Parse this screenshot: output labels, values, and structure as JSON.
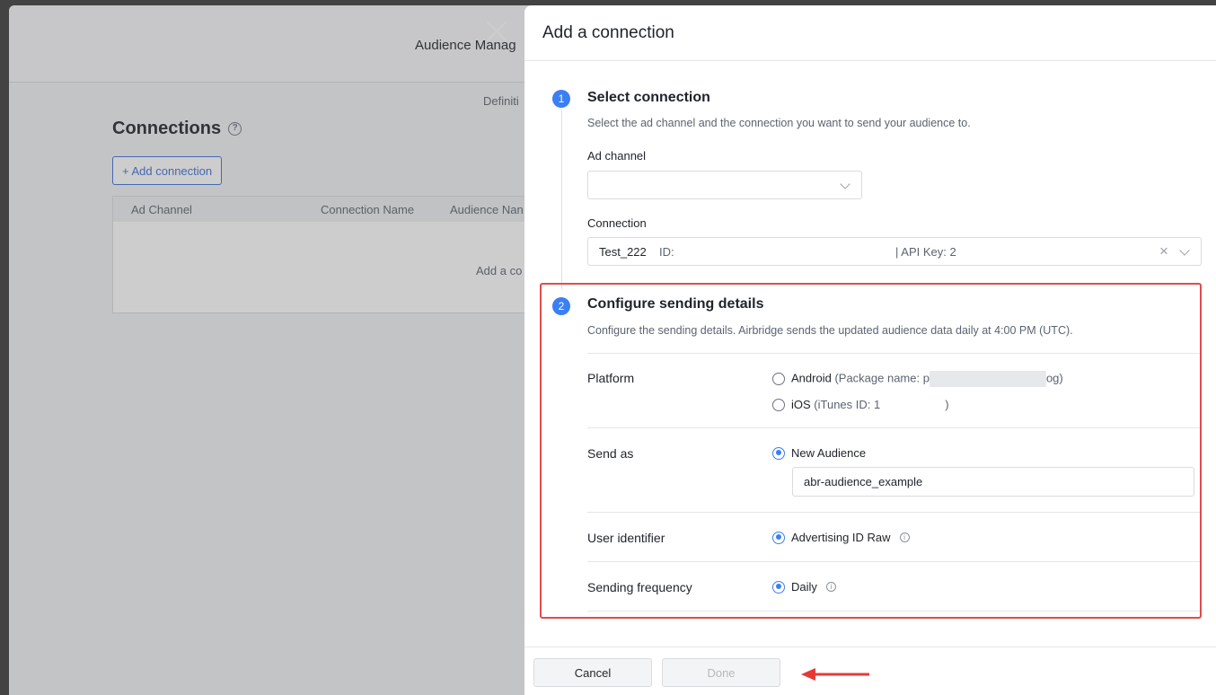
{
  "background": {
    "window_title": "Audience Manag",
    "tab_label": "Definiti",
    "section_heading": "Connections",
    "add_button_label": "+ Add connection",
    "table_headers": [
      "Ad Channel",
      "Connection Name",
      "Audience Nan"
    ],
    "empty_text": "Add a co"
  },
  "drawer": {
    "title": "Add a connection",
    "step1": {
      "number": "1",
      "title": "Select connection",
      "description": "Select the ad channel and the connection you want to send your audience to.",
      "ad_channel_label": "Ad channel",
      "ad_channel_value": "",
      "connection_label": "Connection",
      "connection_name": "Test_222",
      "connection_id_label": "ID:",
      "connection_api_key": "| API Key: 2"
    },
    "step2": {
      "number": "2",
      "title": "Configure sending details",
      "description": "Configure the sending details. Airbridge sends the updated audience data daily at 4:00 PM (UTC).",
      "platform": {
        "label": "Platform",
        "options": [
          {
            "name": "Android",
            "detail_prefix": "(Package name: p",
            "detail_suffix": "og)",
            "selected": false
          },
          {
            "name": "iOS",
            "detail_prefix": "(iTunes ID: 1",
            "detail_suffix": ")",
            "selected": false
          }
        ]
      },
      "send_as": {
        "label": "Send as",
        "option": "New Audience",
        "selected": true,
        "audience_name": "abr-audience_example"
      },
      "user_identifier": {
        "label": "User identifier",
        "option": "Advertising ID Raw",
        "selected": true
      },
      "sending_frequency": {
        "label": "Sending frequency",
        "option": "Daily",
        "selected": true
      }
    },
    "footer": {
      "cancel_label": "Cancel",
      "done_label": "Done"
    }
  },
  "colors": {
    "accent": "#3b7ff2",
    "highlight": "#e24b4b",
    "link": "#3b6fd6"
  }
}
